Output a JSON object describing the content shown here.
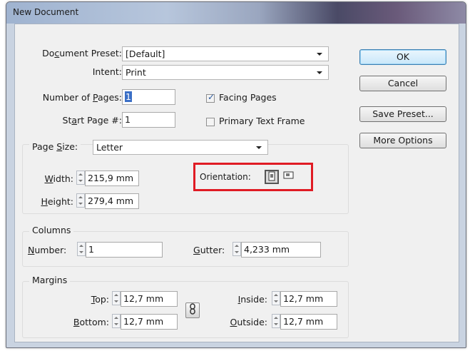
{
  "window": {
    "title": "New Document"
  },
  "preset": {
    "label": "Document Preset:",
    "value": "[Default]"
  },
  "intent": {
    "label": "Intent:",
    "value": "Print"
  },
  "pages": {
    "label": "Number of Pages:",
    "value": "1"
  },
  "start_page": {
    "label": "Start Page #:",
    "value": "1"
  },
  "facing_pages": {
    "label": "Facing Pages",
    "checked": true
  },
  "primary_text_frame": {
    "label": "Primary Text Frame",
    "checked": false
  },
  "page_size": {
    "label": "Page Size:",
    "value": "Letter"
  },
  "width": {
    "label": "Width:",
    "value": "215,9 mm"
  },
  "height": {
    "label": "Height:",
    "value": "279,4 mm"
  },
  "orientation": {
    "label": "Orientation:",
    "selected": "portrait",
    "portrait_icon": "portrait-page-icon",
    "landscape_icon": "landscape-page-icon",
    "highlight_color": "#e01b24"
  },
  "columns": {
    "group_title": "Columns",
    "number_label": "Number:",
    "number_value": "1",
    "gutter_label": "Gutter:",
    "gutter_value": "4,233 mm"
  },
  "margins": {
    "group_title": "Margins",
    "top_label": "Top:",
    "top_value": "12,7 mm",
    "bottom_label": "Bottom:",
    "bottom_value": "12,7 mm",
    "inside_label": "Inside:",
    "inside_value": "12,7 mm",
    "outside_label": "Outside:",
    "outside_value": "12,7 mm",
    "link_icon": "chain-link-icon"
  },
  "buttons": {
    "ok": "OK",
    "cancel": "Cancel",
    "save_preset": "Save Preset...",
    "more_options": "More Options"
  },
  "colors": {
    "accent": "#3c7fb1",
    "highlight_box": "#e01b24"
  }
}
